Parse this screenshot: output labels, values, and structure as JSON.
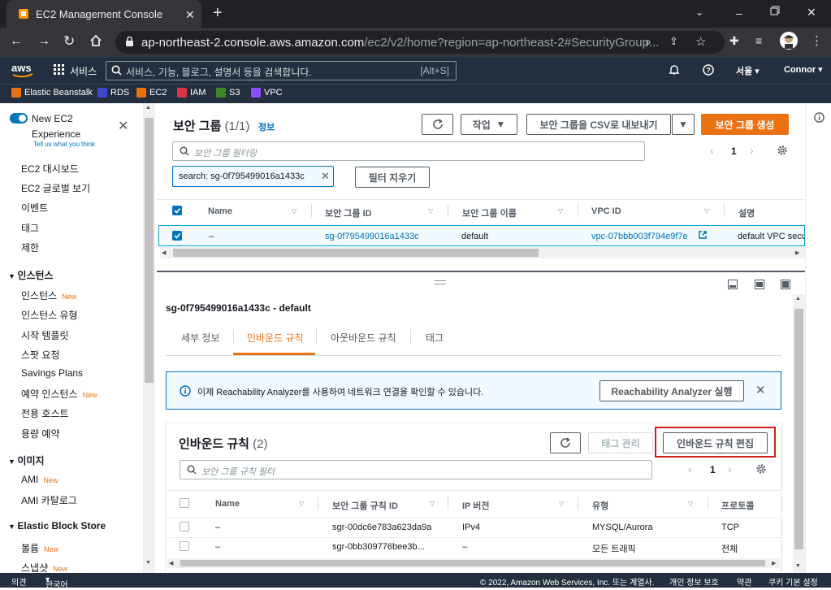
{
  "browser": {
    "tab_title": "EC2 Management Console",
    "url_domain": "ap-northeast-2.console.aws.amazon.com",
    "url_path": "/ec2/v2/home?region=ap-northeast-2#SecurityGroup..."
  },
  "awsnav": {
    "services": "서비스",
    "search_placeholder": "서비스, 기능, 블로그, 설명서 등을 검색합니다.",
    "search_shortcut": "[Alt+S]",
    "region": "서울",
    "user": "Connor"
  },
  "favorites": [
    {
      "label": "Elastic Beanstalk",
      "color": "#ec7211"
    },
    {
      "label": "RDS",
      "color": "#3f48cc"
    },
    {
      "label": "EC2",
      "color": "#ec7211"
    },
    {
      "label": "IAM",
      "color": "#dd344c"
    },
    {
      "label": "S3",
      "color": "#3f8624"
    },
    {
      "label": "VPC",
      "color": "#8c4fff"
    }
  ],
  "sidebar": {
    "new_ec2_line1": "New EC2",
    "new_ec2_line2": "Experience",
    "tell_us": "Tell us what you think",
    "new_badge": "New",
    "top_items": [
      "EC2 대시보드",
      "EC2 글로벌 보기",
      "이벤트",
      "태그",
      "제한"
    ],
    "sec_instances": "인스턴스",
    "instances": [
      {
        "label": "인스턴스",
        "new": true
      },
      {
        "label": "인스턴스 유형",
        "new": false
      },
      {
        "label": "시작 템플릿",
        "new": false
      },
      {
        "label": "스팟 요청",
        "new": false
      },
      {
        "label": "Savings Plans",
        "new": false
      },
      {
        "label": "예약 인스턴스",
        "new": true
      },
      {
        "label": "전용 호스트",
        "new": false
      },
      {
        "label": "용량 예약",
        "new": false
      }
    ],
    "sec_images": "이미지",
    "images": [
      {
        "label": "AMI",
        "new": true
      },
      {
        "label": "AMI 카탈로그",
        "new": false
      }
    ],
    "sec_ebs": "Elastic Block Store",
    "ebs": [
      {
        "label": "볼륨",
        "new": true
      },
      {
        "label": "스냅샷",
        "new": true
      }
    ]
  },
  "sg_list": {
    "title": "보안 그룹",
    "count": "(1/1)",
    "info": "정보",
    "actions": "작업",
    "export_csv": "보안 그룹을 CSV로 내보내기",
    "create": "보안 그룹 생성",
    "filter_placeholder": "보안 그룹 필터링",
    "page": "1",
    "chip_label": "search: sg-0f795499016a1433c",
    "clear_filters": "필터 지우기",
    "columns": [
      "Name",
      "보안 그룹 ID",
      "보안 그룹 이름",
      "VPC ID",
      "설명"
    ],
    "row": {
      "name": "–",
      "sg_id": "sg-0f795499016a1433c",
      "sg_name": "default",
      "vpc_id": "vpc-07bbb003f794e9f7e",
      "desc": "default VPC secu"
    }
  },
  "detail": {
    "title": "sg-0f795499016a1433c - default",
    "tabs": [
      "세부 정보",
      "인바운드 규칙",
      "아웃바운드 규칙",
      "태그"
    ],
    "active_tab": 1,
    "banner_text": "이제 Reachability Analyzer를 사용하여 네트워크 연결을 확인할 수 있습니다.",
    "banner_button": "Reachability Analyzer 실행",
    "rules_title": "인바운드 규칙",
    "rules_count": "(2)",
    "manage_tags": "태그 관리",
    "edit_rules": "인바운드 규칙 편집",
    "rules_filter_placeholder": "보안 그룹 규칙 필터",
    "page": "1",
    "columns": [
      "Name",
      "보안 그룹 규칙 ID",
      "IP 버전",
      "유형",
      "프로토콜"
    ],
    "rows": [
      {
        "name": "–",
        "rule_id": "sgr-00dc6e783a623da9a",
        "ip": "IPv4",
        "type": "MYSQL/Aurora",
        "proto": "TCP"
      },
      {
        "name": "–",
        "rule_id": "sgr-0bb309776bee3b...",
        "ip": "–",
        "type": "모든 트래픽",
        "proto": "전체"
      }
    ]
  },
  "footer": {
    "feedback": "의견",
    "language": "한국어",
    "copyright": "© 2022, Amazon Web Services, Inc. 또는 계열사.",
    "privacy": "개인 정보 보호",
    "terms": "약관",
    "cookies": "쿠키 기본 설정"
  }
}
